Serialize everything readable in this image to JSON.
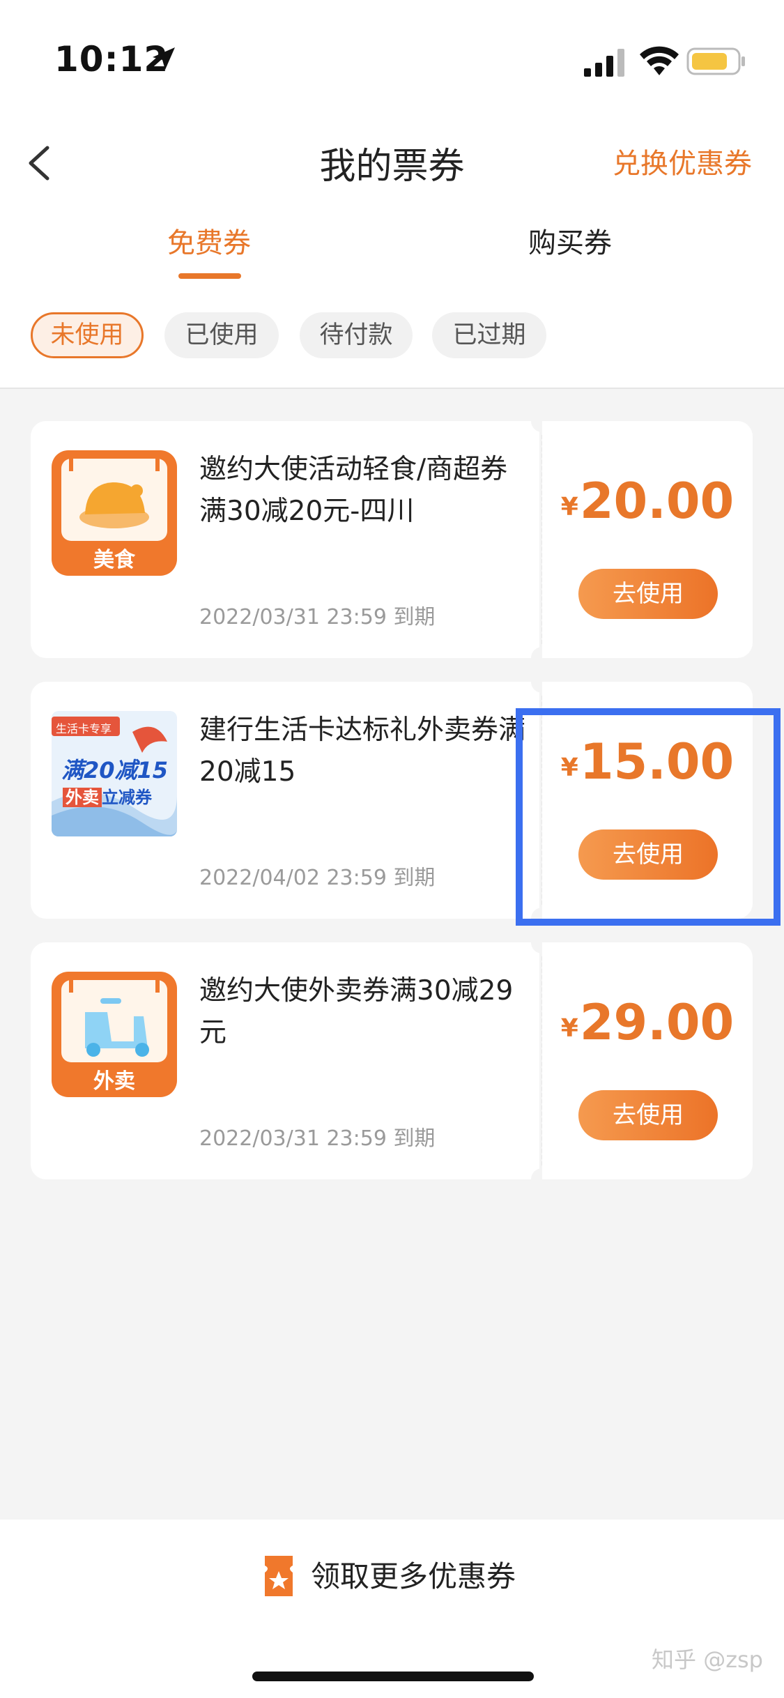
{
  "status_bar": {
    "time": "10:12"
  },
  "header": {
    "title": "我的票券",
    "redeem_label": "兑换优惠券"
  },
  "tabs": [
    {
      "label": "免费券",
      "active": true
    },
    {
      "label": "购买券",
      "active": false
    }
  ],
  "filters": [
    {
      "label": "未使用",
      "active": true
    },
    {
      "label": "已使用",
      "active": false
    },
    {
      "label": "待付款",
      "active": false
    },
    {
      "label": "已过期",
      "active": false
    }
  ],
  "coupons": [
    {
      "icon_label": "美食",
      "icon": "roast-chicken-icon",
      "title": "邀约大使活动轻食/商超券满30减20元-四川",
      "expiry": "2022/03/31 23:59 到期",
      "currency": "¥",
      "amount": "20.00",
      "button_label": "去使用"
    },
    {
      "icon": "waimai-promo-image",
      "image_badge": "生活卡专享",
      "image_headline": "满20减15",
      "image_tag": "外卖",
      "image_tag_suffix": "立减券",
      "title": "建行生活卡达标礼外卖券满20减15",
      "expiry": "2022/04/02 23:59 到期",
      "currency": "¥",
      "amount": "15.00",
      "button_label": "去使用"
    },
    {
      "icon_label": "外卖",
      "icon": "scooter-icon",
      "title": "邀约大使外卖券满30减29元",
      "expiry": "2022/03/31 23:59 到期",
      "currency": "¥",
      "amount": "29.00",
      "button_label": "去使用"
    }
  ],
  "bottom": {
    "label": "领取更多优惠券",
    "watermark": "知乎 @zsp"
  },
  "colors": {
    "accent": "#e8772a",
    "highlight": "#3b6ff0",
    "background": "#f4f4f4"
  }
}
